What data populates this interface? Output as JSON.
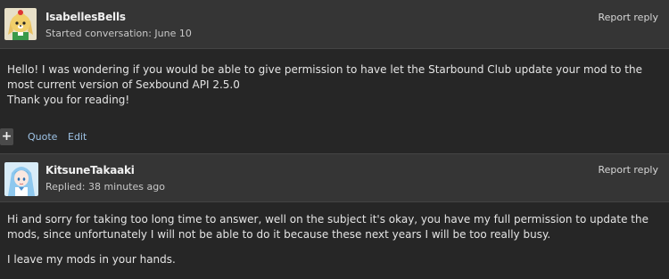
{
  "posts": [
    {
      "username": "IsabellesBells",
      "meta": "Started conversation: June 10",
      "report_label": "Report reply",
      "avatar_icon": "isabelle-dog-avatar",
      "body": [
        "Hello! I was wondering if you would be able to give permission to have let the Starbound Club update your mod to the most current version of Sexbound API 2.5.0",
        "Thank you for reading!"
      ]
    },
    {
      "username": "KitsuneTakaaki",
      "meta": "Replied: 38 minutes ago",
      "report_label": "Report reply",
      "avatar_icon": "anime-girl-avatar",
      "body": [
        "Hi and sorry for taking too long time to answer, well on the subject it's okay, you have my full permission to update the mods, since unfortunately I will not be able to do it because these next years I will be too really busy.",
        "I leave my mods in your hands."
      ]
    }
  ],
  "actions": {
    "plus_label": "+",
    "quote_label": "Quote",
    "edit_label": "Edit"
  },
  "colors": {
    "page_bg": "#262626",
    "header_bg": "#353535",
    "link": "#9ec3e6"
  }
}
